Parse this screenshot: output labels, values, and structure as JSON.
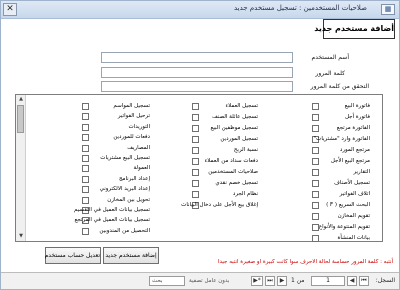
{
  "titlebar": {
    "title": "صلاحيات المستخدمين : تسجيل مستخدم جديد",
    "close_glyph": "✕",
    "tab_icon_glyph": "▦"
  },
  "header": {
    "title": "أضافة مستخدم جديد"
  },
  "fields": [
    {
      "label": "أسم المستخدم",
      "value": ""
    },
    {
      "label": "كلمة المرور",
      "value": ""
    },
    {
      "label": "التحقق من كلمة المرور",
      "value": ""
    }
  ],
  "permissions": {
    "col1": [
      "فاتورة البيع",
      "فاتورة أجل",
      "الفاتورة مرتجع",
      "الفاتورة وارد \"مشتريات\"",
      "مرتجع المورد",
      "مرتجع البيع الأجل",
      "التقارير",
      "تسجيل الأصناف",
      "اتلاف الفواتير",
      "البحث السريع ( F )",
      "تقويم المخازن",
      "تقويم المنتوعة والأنواع",
      "بيانات المنشأة"
    ],
    "col2": [
      "تسجيل العملاء",
      "تسجيل عائلة الصنف",
      "تسجيل موظفين البيع",
      "تسجيل الموردين",
      "نسبة الربح",
      "دفعات سداد من العملاء",
      "صلاحيات المستخدمين",
      "تسجيل خصم نقدي",
      "نظام الجرد",
      "إغلاق بيع الأجل على دخال البيانات"
    ],
    "col3": [
      "تسجيل المواسم",
      "ترحيل الفواتير",
      "التوريدات",
      "دفعات للموردين",
      "المصاريف",
      "تسجيل البيع مشتريات",
      "العمولة",
      "إعداد البرنامج",
      "إعداد البريد الالكتروني",
      "تحويل بين المخازن",
      "تسجيل بيانات العميل في التقسيم",
      "تسجيل بيانات العميل في المرتجع",
      "التحصيل من المندوبين"
    ]
  },
  "scrollbar": {
    "up_glyph": "▲",
    "down_glyph": "▼"
  },
  "buttons": {
    "add_user": "إضافة مستخدم جديد",
    "edit_user": "تعديل حساب مستخدم"
  },
  "notice": "أنتبه : كلمة المرور حساسة لحالة الاحرف سوا كانت كبيرة او صغيرة انتبه جيدا",
  "navbar": {
    "record_label": "السجل:",
    "current": "1",
    "of_text": "من 1",
    "first_glyph": "⏮",
    "prev_glyph": "◀",
    "next_glyph": "▶",
    "last_glyph": "⏭",
    "new_glyph": "▶*",
    "filter_text": "بدون عامل تصفية",
    "search_text": "بحث"
  }
}
